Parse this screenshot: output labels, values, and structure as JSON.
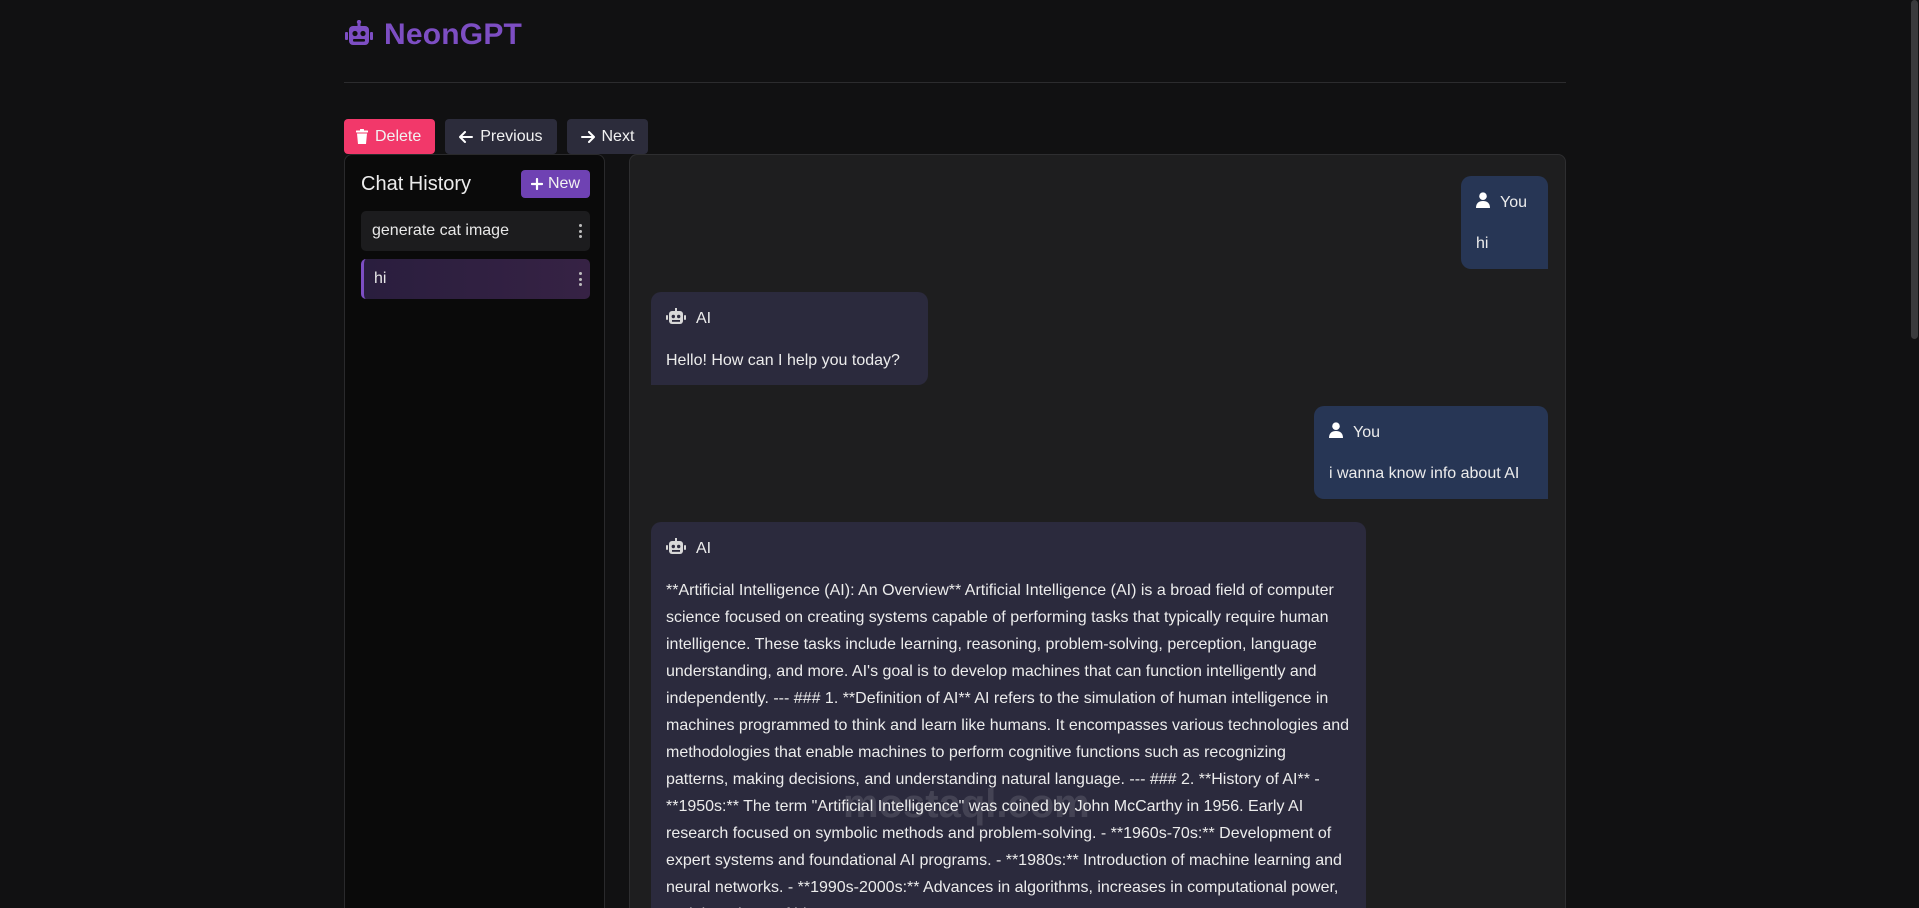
{
  "app": {
    "name": "NeonGPT",
    "accent_color": "#7d4ec3"
  },
  "toolbar": {
    "delete_label": "Delete",
    "previous_label": "Previous",
    "next_label": "Next"
  },
  "sidebar": {
    "title": "Chat History",
    "new_label": "New",
    "items": [
      {
        "label": "generate cat image",
        "active": false
      },
      {
        "label": "hi",
        "active": true
      }
    ]
  },
  "chat": {
    "messages": [
      {
        "role": "user",
        "author": "You",
        "text": "hi"
      },
      {
        "role": "ai",
        "author": "AI",
        "text": "Hello! How can I help you today?"
      },
      {
        "role": "user",
        "author": "You",
        "text": "i wanna know info about AI"
      },
      {
        "role": "ai",
        "author": "AI",
        "text": "**Artificial Intelligence (AI): An Overview** Artificial Intelligence (AI) is a broad field of computer science focused on creating systems capable of performing tasks that typically require human intelligence. These tasks include learning, reasoning, problem-solving, perception, language understanding, and more. AI's goal is to develop machines that can function intelligently and independently. --- ### 1. **Definition of AI** AI refers to the simulation of human intelligence in machines programmed to think and learn like humans. It encompasses various technologies and methodologies that enable machines to perform cognitive functions such as recognizing patterns, making decisions, and understanding natural language. --- ### 2. **History of AI** - **1950s:** The term \"Artificial Intelligence\" was coined by John McCarthy in 1956. Early AI research focused on symbolic methods and problem-solving. - **1960s-70s:** Development of expert systems and foundational AI programs. - **1980s:** Introduction of machine learning and neural networks. - **1990s-2000s:** Advances in algorithms, increases in computational power, and the advent of big"
      }
    ]
  },
  "watermark": {
    "text": "mostaql.com"
  }
}
